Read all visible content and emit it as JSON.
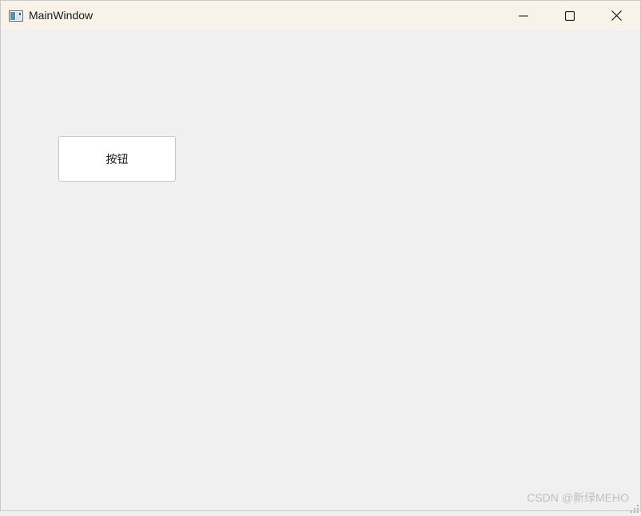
{
  "window": {
    "title": "MainWindow"
  },
  "titlebar": {
    "icons": {
      "app": "app-window-icon",
      "minimize": "minimize-icon",
      "maximize": "maximize-icon",
      "close": "close-icon"
    }
  },
  "main": {
    "button_label": "按钮"
  },
  "watermark": {
    "text": "CSDN @新绿MEHO"
  },
  "colors": {
    "titlebar_bg": "#f8f2e8",
    "client_bg": "#f0f0f0",
    "button_bg": "#ffffff"
  }
}
